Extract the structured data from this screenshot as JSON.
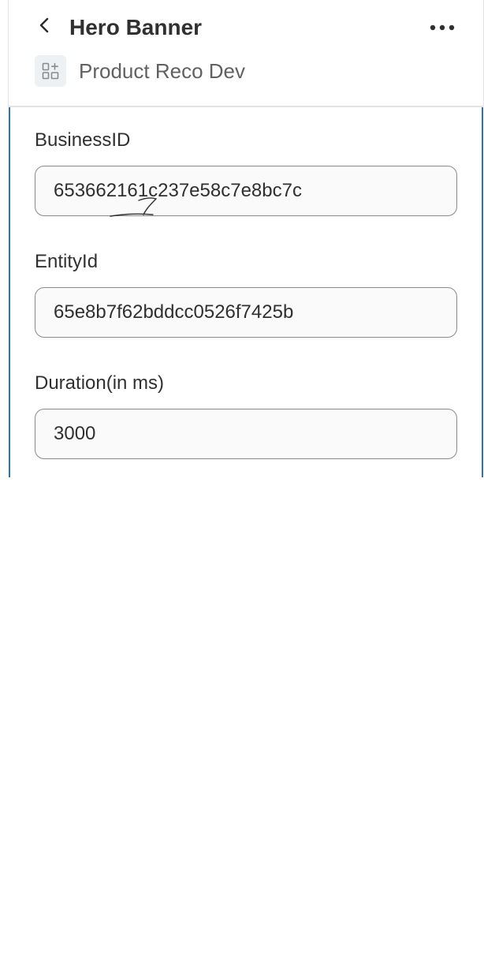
{
  "header": {
    "title": "Hero Banner",
    "app_name": "Product Reco Dev",
    "back_icon": "chevron-left-icon",
    "more_icon": "horizontal-dots-icon",
    "app_icon": "app-grid-icon"
  },
  "form": {
    "fields": [
      {
        "label": "BusinessID",
        "value": "653662161c237e58c7e8bc7c"
      },
      {
        "label": "EntityId",
        "value": "65e8b7f62bddcc0526f7425b"
      },
      {
        "label": "Duration(in ms)",
        "value": "3000"
      }
    ]
  },
  "colors": {
    "accent_border": "#2c6ecb",
    "text_primary": "#303030",
    "text_secondary": "#616161",
    "input_background": "#fafafa",
    "input_border": "#8a8a8a"
  }
}
